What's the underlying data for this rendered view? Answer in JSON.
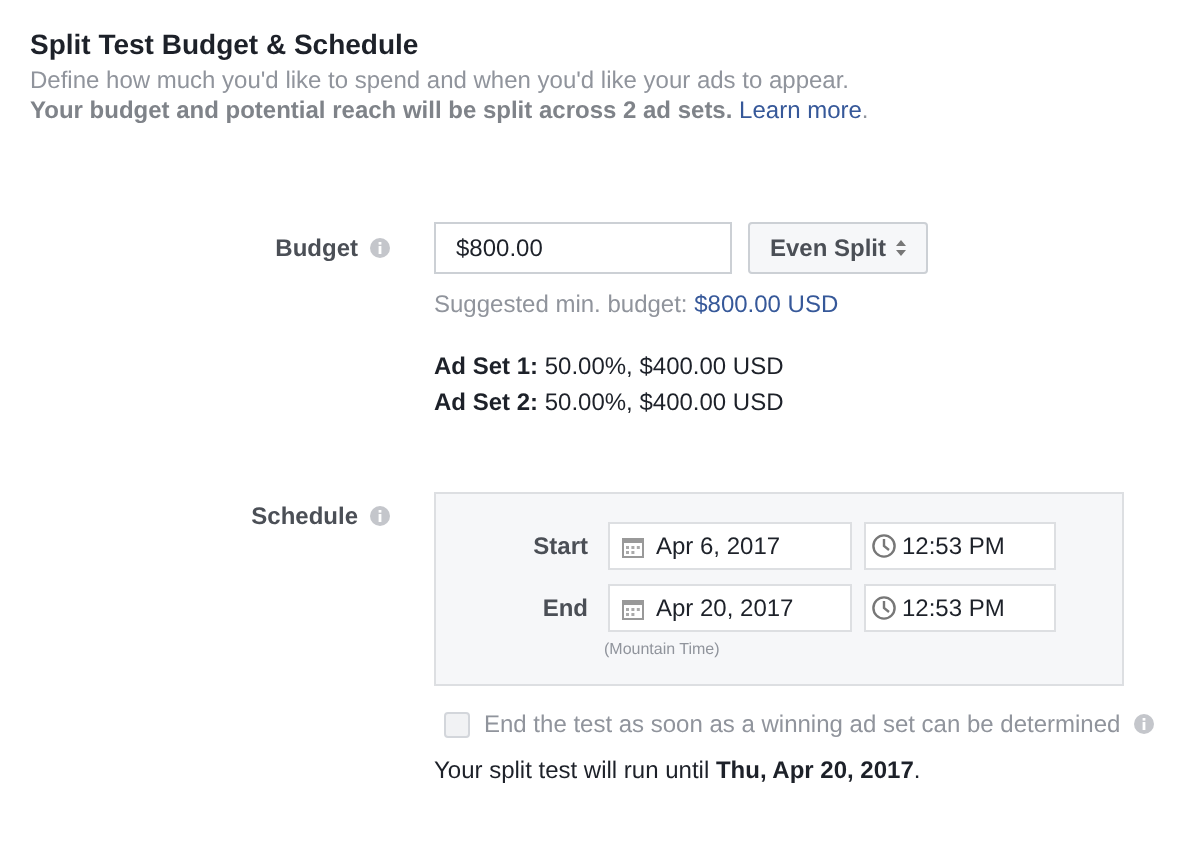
{
  "header": {
    "title": "Split Test Budget & Schedule",
    "description": "Define how much you'd like to spend and when you'd like your ads to appear.",
    "note": "**Your budget and potential reach will be split across 2 ad sets.** ",
    "note_link": "Learn more",
    "note_end": "."
  },
  "budget": {
    "label": "Budget",
    "value": "$800.00",
    "split_button": "Even Split",
    "suggested": "Suggested min. budget: ",
    "suggested_amount": "$800.00 USD",
    "ad_sets": [
      "**Ad Set 1:** 50.00%, $400.00 USD",
      "**Ad Set 2:** 50.00%, $400.00 USD"
    ]
  },
  "schedule": {
    "label": "Schedule",
    "rows": [
      {
        "label": "Start",
        "date": "Apr 6, 2017",
        "time": "12:53 PM"
      },
      {
        "label": "End",
        "date": "Apr 20, 2017",
        "time": "12:53 PM"
      }
    ],
    "timezone": "(Mountain Time)"
  },
  "early_end": {
    "label": "End the test as soon as a winning ad set can be determined",
    "checked": false,
    "disabled": true
  },
  "summary": "Your split test will run until **Thu, Apr 20, 2017**."
}
